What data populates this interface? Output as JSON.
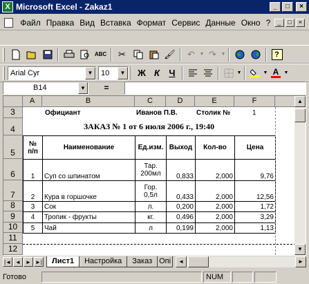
{
  "window": {
    "title": "Microsoft Excel - Zakaz1",
    "app_icon": "excel-icon"
  },
  "window_buttons": [
    "_",
    "□",
    "×"
  ],
  "menu": {
    "items": [
      "Файл",
      "Правка",
      "Вид",
      "Вставка",
      "Формат",
      "Сервис",
      "Данные",
      "Окно",
      "?"
    ],
    "mdi_buttons": [
      "_",
      "□",
      "×"
    ]
  },
  "toolbar_standard": {
    "icons": [
      "new-icon",
      "open-icon",
      "save-icon",
      "print-icon",
      "print-preview-icon",
      "spelling-icon",
      "cut-icon",
      "copy-icon",
      "paste-icon",
      "format-painter-icon",
      "undo-icon",
      "redo-icon",
      "web-icon",
      "hyperlink-icon",
      "help-icon"
    ]
  },
  "toolbar_format": {
    "font_name": "Arial Cyr",
    "font_size": "10",
    "bold": "Ж",
    "italic": "К",
    "underline": "Ч",
    "fill_color": "#ffff00",
    "font_color": "#ff0000"
  },
  "formula_bar": {
    "name_box": "B14",
    "equals": "=",
    "value": ""
  },
  "columns": [
    "A",
    "B",
    "C",
    "D",
    "E",
    "F"
  ],
  "rows": [
    "3",
    "4",
    "5",
    "6",
    "7",
    "8",
    "9",
    "10",
    "11",
    "12"
  ],
  "sheet": {
    "r3": {
      "b": "Официант",
      "c": "Иванов П.В.",
      "e": "Столик №",
      "f": "1"
    },
    "title": "ЗАКАЗ № 1  от   6 июля 2006 г., 19:40",
    "headers": [
      "№\nп/п",
      "Наименование",
      "Ед.изм.",
      "Выход",
      "Кол-во",
      "Цена"
    ],
    "items": [
      {
        "n": "1",
        "name": "Суп со шпинатом",
        "unit": "Тар.\n200мл",
        "out": "0,833",
        "qty": "2,000",
        "price": "9,76"
      },
      {
        "n": "2",
        "name": "Кура в горшочке",
        "unit": "Гор.\n0,5л",
        "out": "0,433",
        "qty": "2,000",
        "price": "12,56"
      },
      {
        "n": "3",
        "name": "Сок",
        "unit": "л.",
        "out": "0,200",
        "qty": "2,000",
        "price": "1,72"
      },
      {
        "n": "4",
        "name": "Тропик - фрукты",
        "unit": "кг.",
        "out": "0,496",
        "qty": "2,000",
        "price": "3,29"
      },
      {
        "n": "5",
        "name": "Чай",
        "unit": "л",
        "out": "0,199",
        "qty": "2,000",
        "price": "1,13"
      }
    ]
  },
  "tabs": [
    "Лист1",
    "Настройка",
    "Заказ",
    "Опі"
  ],
  "tab_nav": [
    "|◄",
    "◄",
    "►",
    "►|"
  ],
  "status": {
    "ready": "Готово",
    "num": "NUM"
  }
}
